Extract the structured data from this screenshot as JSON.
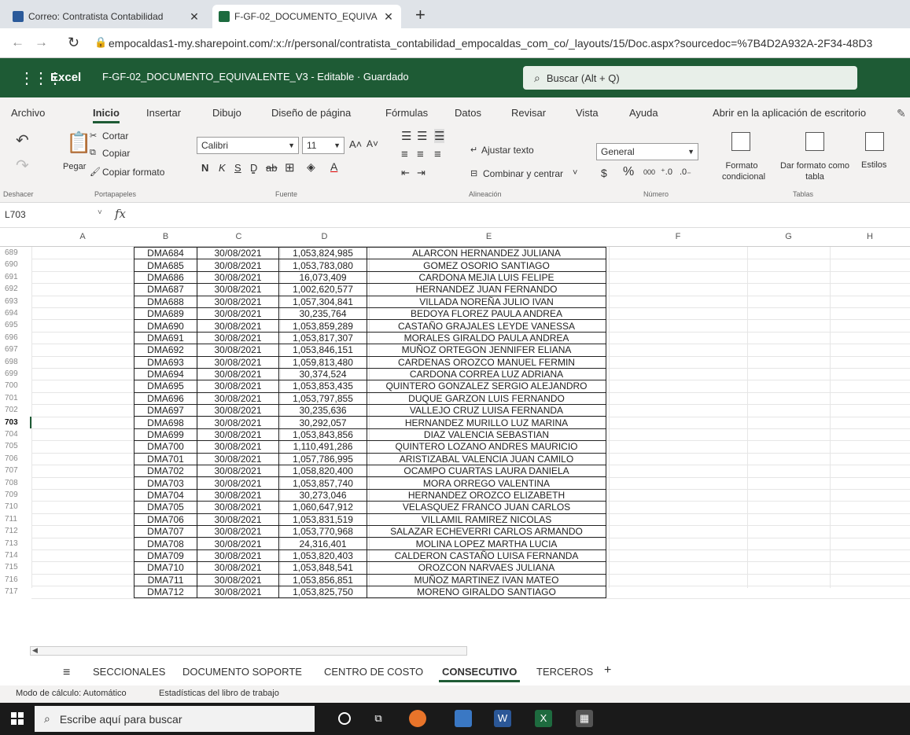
{
  "browser": {
    "tabs": [
      {
        "label": "Correo: Contratista Contabilidad"
      },
      {
        "label": "F-GF-02_DOCUMENTO_EQUIVA"
      }
    ],
    "url": "empocaldas1-my.sharepoint.com/:x:/r/personal/contratista_contabilidad_empocaldas_com_co/_layouts/15/Doc.aspx?sourcedoc=%7B4D2A932A-2F34-48D3"
  },
  "app": {
    "name": "Excel",
    "doc_title": "F-GF-02_DOCUMENTO_EQUIVALENTE_V3 - Editable  ·  Guardado",
    "search_placeholder": "Buscar (Alt + Q)"
  },
  "menu": {
    "tabs": [
      "Archivo",
      "Inicio",
      "Insertar",
      "Dibujo",
      "Diseño de página",
      "Fórmulas",
      "Datos",
      "Revisar",
      "Vista",
      "Ayuda",
      "Abrir en la aplicación de escritorio"
    ]
  },
  "ribbon": {
    "undo_label": "Deshacer",
    "paste_label": "Pegar",
    "cut_label": "Cortar",
    "copy_label": "Copiar",
    "format_painter_label": "Copiar formato",
    "clipboard_group": "Portapapeles",
    "font_name": "Calibri",
    "font_size": "11",
    "font_group": "Fuente",
    "bold": "N",
    "italic": "K",
    "underline": "S",
    "wrap_text": "Ajustar texto",
    "merge_center": "Combinar y centrar",
    "alignment_group": "Alineación",
    "number_format": "General",
    "currency": "$",
    "percent": "%",
    "thousands": "000",
    "number_group": "Número",
    "conditional_format": "Formato condicional",
    "format_as_table": "Dar formato como tabla",
    "styles": "Estilos",
    "tables_group": "Tablas"
  },
  "formula_bar": {
    "cell_ref": "L703",
    "fx": "fx"
  },
  "columns": [
    "A",
    "B",
    "C",
    "D",
    "E",
    "F",
    "G",
    "H"
  ],
  "active_row": "703",
  "rows": [
    {
      "n": "689",
      "code": "DMA684",
      "date": "30/08/2021",
      "id": "1,053,824,985",
      "name": "ALARCON HERNANDEZ JULIANA"
    },
    {
      "n": "690",
      "code": "DMA685",
      "date": "30/08/2021",
      "id": "1,053,783,080",
      "name": "GOMEZ OSORIO SANTIAGO"
    },
    {
      "n": "691",
      "code": "DMA686",
      "date": "30/08/2021",
      "id": "16,073,409",
      "name": "CARDONA MEJIA LUIS FELIPE"
    },
    {
      "n": "692",
      "code": "DMA687",
      "date": "30/08/2021",
      "id": "1,002,620,577",
      "name": "HERNANDEZ JUAN FERNANDO"
    },
    {
      "n": "693",
      "code": "DMA688",
      "date": "30/08/2021",
      "id": "1,057,304,841",
      "name": "VILLADA NOREÑA JULIO IVAN"
    },
    {
      "n": "694",
      "code": "DMA689",
      "date": "30/08/2021",
      "id": "30,235,764",
      "name": "BEDOYA FLOREZ PAULA ANDREA"
    },
    {
      "n": "695",
      "code": "DMA690",
      "date": "30/08/2021",
      "id": "1,053,859,289",
      "name": "CASTAÑO GRAJALES LEYDE VANESSA"
    },
    {
      "n": "696",
      "code": "DMA691",
      "date": "30/08/2021",
      "id": "1,053,817,307",
      "name": "MORALES GIRALDO PAULA ANDREA"
    },
    {
      "n": "697",
      "code": "DMA692",
      "date": "30/08/2021",
      "id": "1,053,846,151",
      "name": "MUÑOZ ORTEGON JENNIFER ELIANA"
    },
    {
      "n": "698",
      "code": "DMA693",
      "date": "30/08/2021",
      "id": "1,059,813,480",
      "name": "CARDENAS OROZCO MANUEL FERMIN"
    },
    {
      "n": "699",
      "code": "DMA694",
      "date": "30/08/2021",
      "id": "30,374,524",
      "name": "CARDONA CORREA LUZ ADRIANA"
    },
    {
      "n": "700",
      "code": "DMA695",
      "date": "30/08/2021",
      "id": "1,053,853,435",
      "name": "QUINTERO GONZALEZ SERGIO ALEJANDRO"
    },
    {
      "n": "701",
      "code": "DMA696",
      "date": "30/08/2021",
      "id": "1,053,797,855",
      "name": "DUQUE GARZON LUIS FERNANDO"
    },
    {
      "n": "702",
      "code": "DMA697",
      "date": "30/08/2021",
      "id": "30,235,636",
      "name": "VALLEJO CRUZ LUISA FERNANDA"
    },
    {
      "n": "703",
      "code": "DMA698",
      "date": "30/08/2021",
      "id": "30,292,057",
      "name": "HERNANDEZ MURILLO LUZ MARINA"
    },
    {
      "n": "704",
      "code": "DMA699",
      "date": "30/08/2021",
      "id": "1,053,843,856",
      "name": "DIAZ VALENCIA SEBASTIAN"
    },
    {
      "n": "705",
      "code": "DMA700",
      "date": "30/08/2021",
      "id": "1,110,491,286",
      "name": "QUINTERO LOZANO ANDRES MAURICIO"
    },
    {
      "n": "706",
      "code": "DMA701",
      "date": "30/08/2021",
      "id": "1,057,786,995",
      "name": "ARISTIZABAL VALENCIA JUAN CAMILO"
    },
    {
      "n": "707",
      "code": "DMA702",
      "date": "30/08/2021",
      "id": "1,058,820,400",
      "name": "OCAMPO CUARTAS LAURA DANIELA"
    },
    {
      "n": "708",
      "code": "DMA703",
      "date": "30/08/2021",
      "id": "1,053,857,740",
      "name": "MORA ORREGO VALENTINA"
    },
    {
      "n": "709",
      "code": "DMA704",
      "date": "30/08/2021",
      "id": "30,273,046",
      "name": "HERNANDEZ OROZCO ELIZABETH"
    },
    {
      "n": "710",
      "code": "DMA705",
      "date": "30/08/2021",
      "id": "1,060,647,912",
      "name": "VELASQUEZ FRANCO JUAN CARLOS"
    },
    {
      "n": "711",
      "code": "DMA706",
      "date": "30/08/2021",
      "id": "1,053,831,519",
      "name": "VILLAMIL RAMIREZ NICOLAS"
    },
    {
      "n": "712",
      "code": "DMA707",
      "date": "30/08/2021",
      "id": "1,053,770,968",
      "name": "SALAZAR ECHEVERRI CARLOS ARMANDO"
    },
    {
      "n": "713",
      "code": "DMA708",
      "date": "30/08/2021",
      "id": "24,316,401",
      "name": "MOLINA LOPEZ MARTHA LUCIA"
    },
    {
      "n": "714",
      "code": "DMA709",
      "date": "30/08/2021",
      "id": "1,053,820,403",
      "name": "CALDERON CASTAÑO LUISA FERNANDA"
    },
    {
      "n": "715",
      "code": "DMA710",
      "date": "30/08/2021",
      "id": "1,053,848,541",
      "name": "OROZCON NARVAES JULIANA"
    },
    {
      "n": "716",
      "code": "DMA711",
      "date": "30/08/2021",
      "id": "1,053,856,851",
      "name": "MUÑOZ MARTINEZ IVAN MATEO"
    },
    {
      "n": "717",
      "code": "DMA712",
      "date": "30/08/2021",
      "id": "1,053,825,750",
      "name": "MORENO GIRALDO SANTIAGO"
    }
  ],
  "sheets": {
    "tabs": [
      "SECCIONALES",
      "DOCUMENTO SOPORTE",
      "CENTRO DE COSTO",
      "CONSECUTIVO",
      "TERCEROS"
    ],
    "active": "CONSECUTIVO",
    "add": "+"
  },
  "status": {
    "calc_mode": "Modo de cálculo: Automático",
    "workbook_stats": "Estadísticas del libro de trabajo"
  },
  "taskbar": {
    "search_placeholder": "Escribe aquí para buscar"
  },
  "colors": {
    "excel_green": "#1e5b35",
    "ribbon_bg": "#f3f2f1",
    "taskbar_bg": "#1a1a1a"
  }
}
